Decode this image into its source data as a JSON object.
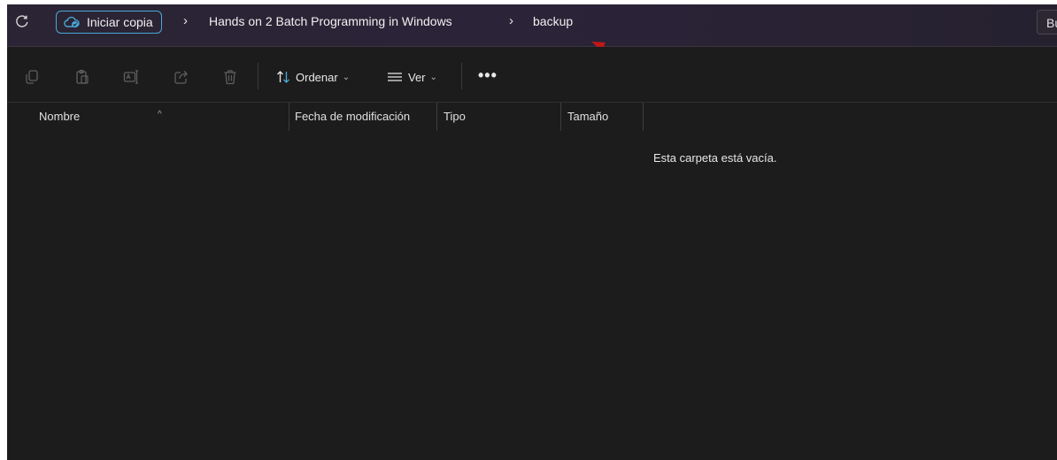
{
  "addressbar": {
    "pill_label": "Iniciar copia",
    "crumbs": [
      "Hands on 2 Batch Programming in Windows",
      "backup"
    ],
    "separator": "›",
    "search_text": "Bu"
  },
  "toolbar": {
    "icons": [
      "copy-icon",
      "paste-icon",
      "rename-icon",
      "share-icon",
      "delete-icon"
    ],
    "sort_label": "Ordenar",
    "view_label": "Ver",
    "more_label": "•••"
  },
  "columns": {
    "name": "Nombre",
    "modified": "Fecha de modificación",
    "type": "Tipo",
    "size": "Tamaño"
  },
  "empty_message": "Esta carpeta está vacía.",
  "colors": {
    "background": "#1c1c1c",
    "address_bar": "#2b2338",
    "accent": "#4aa8d8",
    "annotation_arrow": "#c01818"
  }
}
